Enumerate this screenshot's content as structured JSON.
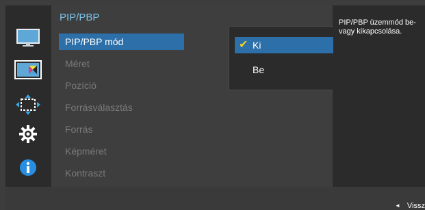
{
  "menu": {
    "title": "PIP/PBP",
    "items": [
      {
        "label": "PIP/PBP mód"
      },
      {
        "label": "Méret"
      },
      {
        "label": "Pozíció"
      },
      {
        "label": "Forrásválasztás"
      },
      {
        "label": "Forrás"
      },
      {
        "label": "Képméret"
      },
      {
        "label": "Kontraszt"
      }
    ]
  },
  "popup": {
    "options": [
      {
        "label": "Ki",
        "checked": true
      },
      {
        "label": "Be",
        "checked": false
      }
    ],
    "check_icon": "✔"
  },
  "help": {
    "text": "PIP/PBP üzemmód be- vagy kikapcsolása."
  },
  "footer": {
    "back_label": "Vissz",
    "back_icon": "◄"
  },
  "icons": [
    "monitor-icon",
    "pip-icon",
    "size-icon",
    "gear-icon",
    "info-icon"
  ],
  "colors": {
    "accent": "#2d6fa8",
    "title": "#7ec3ea",
    "check": "#f0d020"
  }
}
